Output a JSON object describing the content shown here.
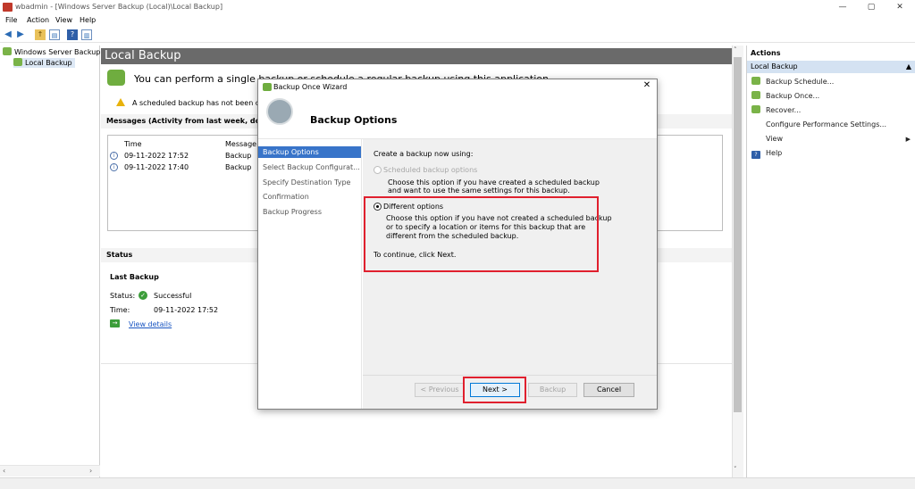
{
  "window": {
    "title": "wbadmin - [Windows Server Backup (Local)\\Local Backup]",
    "minimize": "—",
    "maximize": "▢",
    "close": "✕"
  },
  "menu": [
    "File",
    "Action",
    "View",
    "Help"
  ],
  "tree": {
    "root": "Windows Server Backup (L",
    "child": "Local Backup"
  },
  "center": {
    "header": "Local Backup",
    "banner": "You can perform a single backup or schedule a regular backup using this application.",
    "warning": "A scheduled backup has not been configured for this computer.",
    "messages_header": "Messages (Activity from last week, double click on the message to see details)",
    "columns": [
      "Time",
      "Message"
    ],
    "rows": [
      {
        "time": "09-11-2022 17:52",
        "message": "Backup"
      },
      {
        "time": "09-11-2022 17:40",
        "message": "Backup"
      }
    ],
    "status_header": "Status",
    "last_backup": "Last Backup",
    "status_label": "Status:",
    "status_value": "Successful",
    "time_label": "Time:",
    "time_value": "09-11-2022 17:52",
    "view_details": "View details"
  },
  "actions": {
    "header": "Actions",
    "section": "Local Backup",
    "items": [
      "Backup Schedule...",
      "Backup Once...",
      "Recover...",
      "Configure Performance Settings...",
      "View",
      "Help"
    ]
  },
  "dialog": {
    "title": "Backup Once Wizard",
    "close": "✕",
    "heading": "Backup Options",
    "nav": [
      "Backup Options",
      "Select Backup Configurat...",
      "Specify Destination Type",
      "Confirmation",
      "Backup Progress"
    ],
    "prompt": "Create a backup now using:",
    "opt1_label": "Scheduled backup options",
    "opt1_desc1": "Choose this option if you have created a scheduled backup",
    "opt1_desc2": "and want to use the same settings for this backup.",
    "opt2_label": "Different options",
    "opt2_desc1": "Choose this option if you have not created a scheduled backup",
    "opt2_desc2": "or to specify a location or items for this backup that are",
    "opt2_desc3": "different from the scheduled backup.",
    "continue": "To continue, click Next.",
    "btn_previous": "< Previous",
    "btn_next": "Next >",
    "btn_backup": "Backup",
    "btn_cancel": "Cancel",
    "selected_option": "Different options"
  },
  "colors": {
    "highlight": "#e0202e",
    "nav_selected": "#3874c9",
    "header_bar": "#6a6a6a"
  }
}
